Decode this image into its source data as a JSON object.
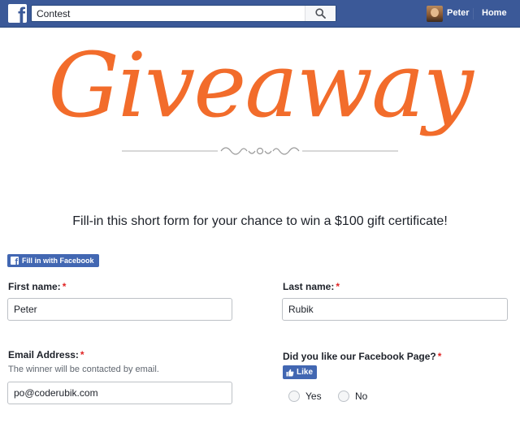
{
  "topbar": {
    "search_value": "Contest",
    "user_name": "Peter",
    "home_label": "Home"
  },
  "giveaway": {
    "headline": "Giveaway",
    "subtitle": "Fill-in this short form for your chance to win a $100 gift certificate!",
    "accent_color": "#f26c2b"
  },
  "fill_in_button": {
    "label": "Fill in with Facebook"
  },
  "form": {
    "first_name": {
      "label": "First name:",
      "required": "*",
      "value": "Peter"
    },
    "last_name": {
      "label": "Last name:",
      "required": "*",
      "value": "Rubik"
    },
    "email": {
      "label": "Email Address:",
      "required": "*",
      "hint": "The winner will be contacted by email.",
      "value": "po@coderubik.com"
    },
    "like_question": {
      "label": "Did you like our Facebook Page?",
      "required": "*",
      "like_button": "Like",
      "options": [
        "Yes",
        "No"
      ]
    }
  },
  "colors": {
    "brand": "#3b5998",
    "button_blue": "#4267b2",
    "required": "#e02424"
  }
}
